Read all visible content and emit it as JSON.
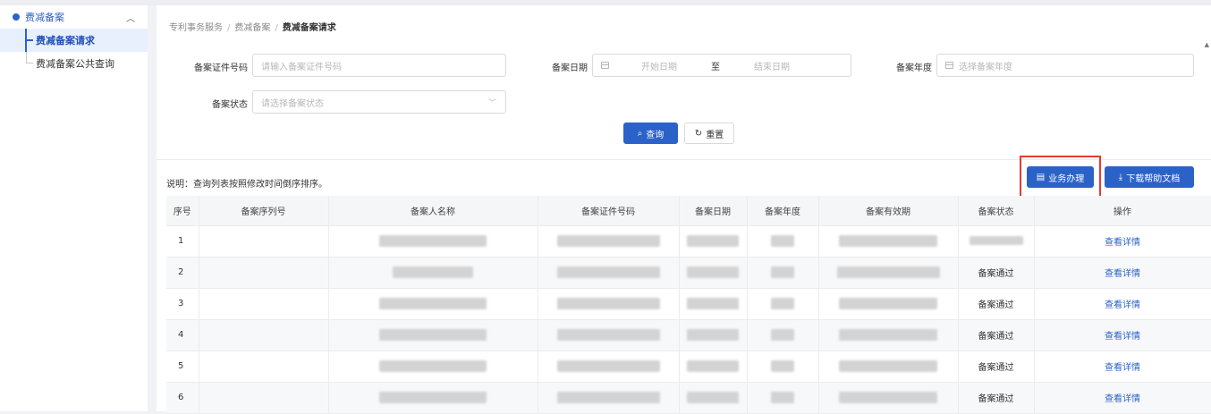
{
  "sidebar": {
    "group_label": "费减备案",
    "items": [
      {
        "label": "费减备案请求",
        "active": true
      },
      {
        "label": "费减备案公共查询",
        "active": false
      }
    ]
  },
  "breadcrumb": [
    "专利事务服务",
    "费减备案",
    "费减备案请求"
  ],
  "filters": {
    "cert_label": "备案证件号码",
    "cert_placeholder": "请输入备案证件号码",
    "date_label": "备案日期",
    "date_start_placeholder": "开始日期",
    "date_sep": "至",
    "date_end_placeholder": "结束日期",
    "year_label": "备案年度",
    "year_placeholder": "选择备案年度",
    "status_label": "备案状态",
    "status_placeholder": "请选择备案状态"
  },
  "actions": {
    "search_label": "查询",
    "reset_label": "重置",
    "business_label": "业务办理",
    "download_label": "下载帮助文档"
  },
  "note": "说明：查询列表按照修改时间倒序排序。",
  "table": {
    "columns": [
      "序号",
      "备案序列号",
      "备案人名称",
      "备案证件号码",
      "备案日期",
      "备案年度",
      "备案有效期",
      "备案状态",
      "操作"
    ],
    "rows": [
      {
        "idx": "1",
        "status": "",
        "action": "查看详情"
      },
      {
        "idx": "2",
        "status": "备案通过",
        "action": "查看详情"
      },
      {
        "idx": "3",
        "status": "备案通过",
        "action": "查看详情"
      },
      {
        "idx": "4",
        "status": "备案通过",
        "action": "查看详情"
      },
      {
        "idx": "5",
        "status": "备案通过",
        "action": "查看详情"
      },
      {
        "idx": "6",
        "status": "备案通过",
        "action": "查看详情"
      }
    ]
  },
  "colors": {
    "primary": "#2b62c8",
    "highlight": "#e53935"
  }
}
